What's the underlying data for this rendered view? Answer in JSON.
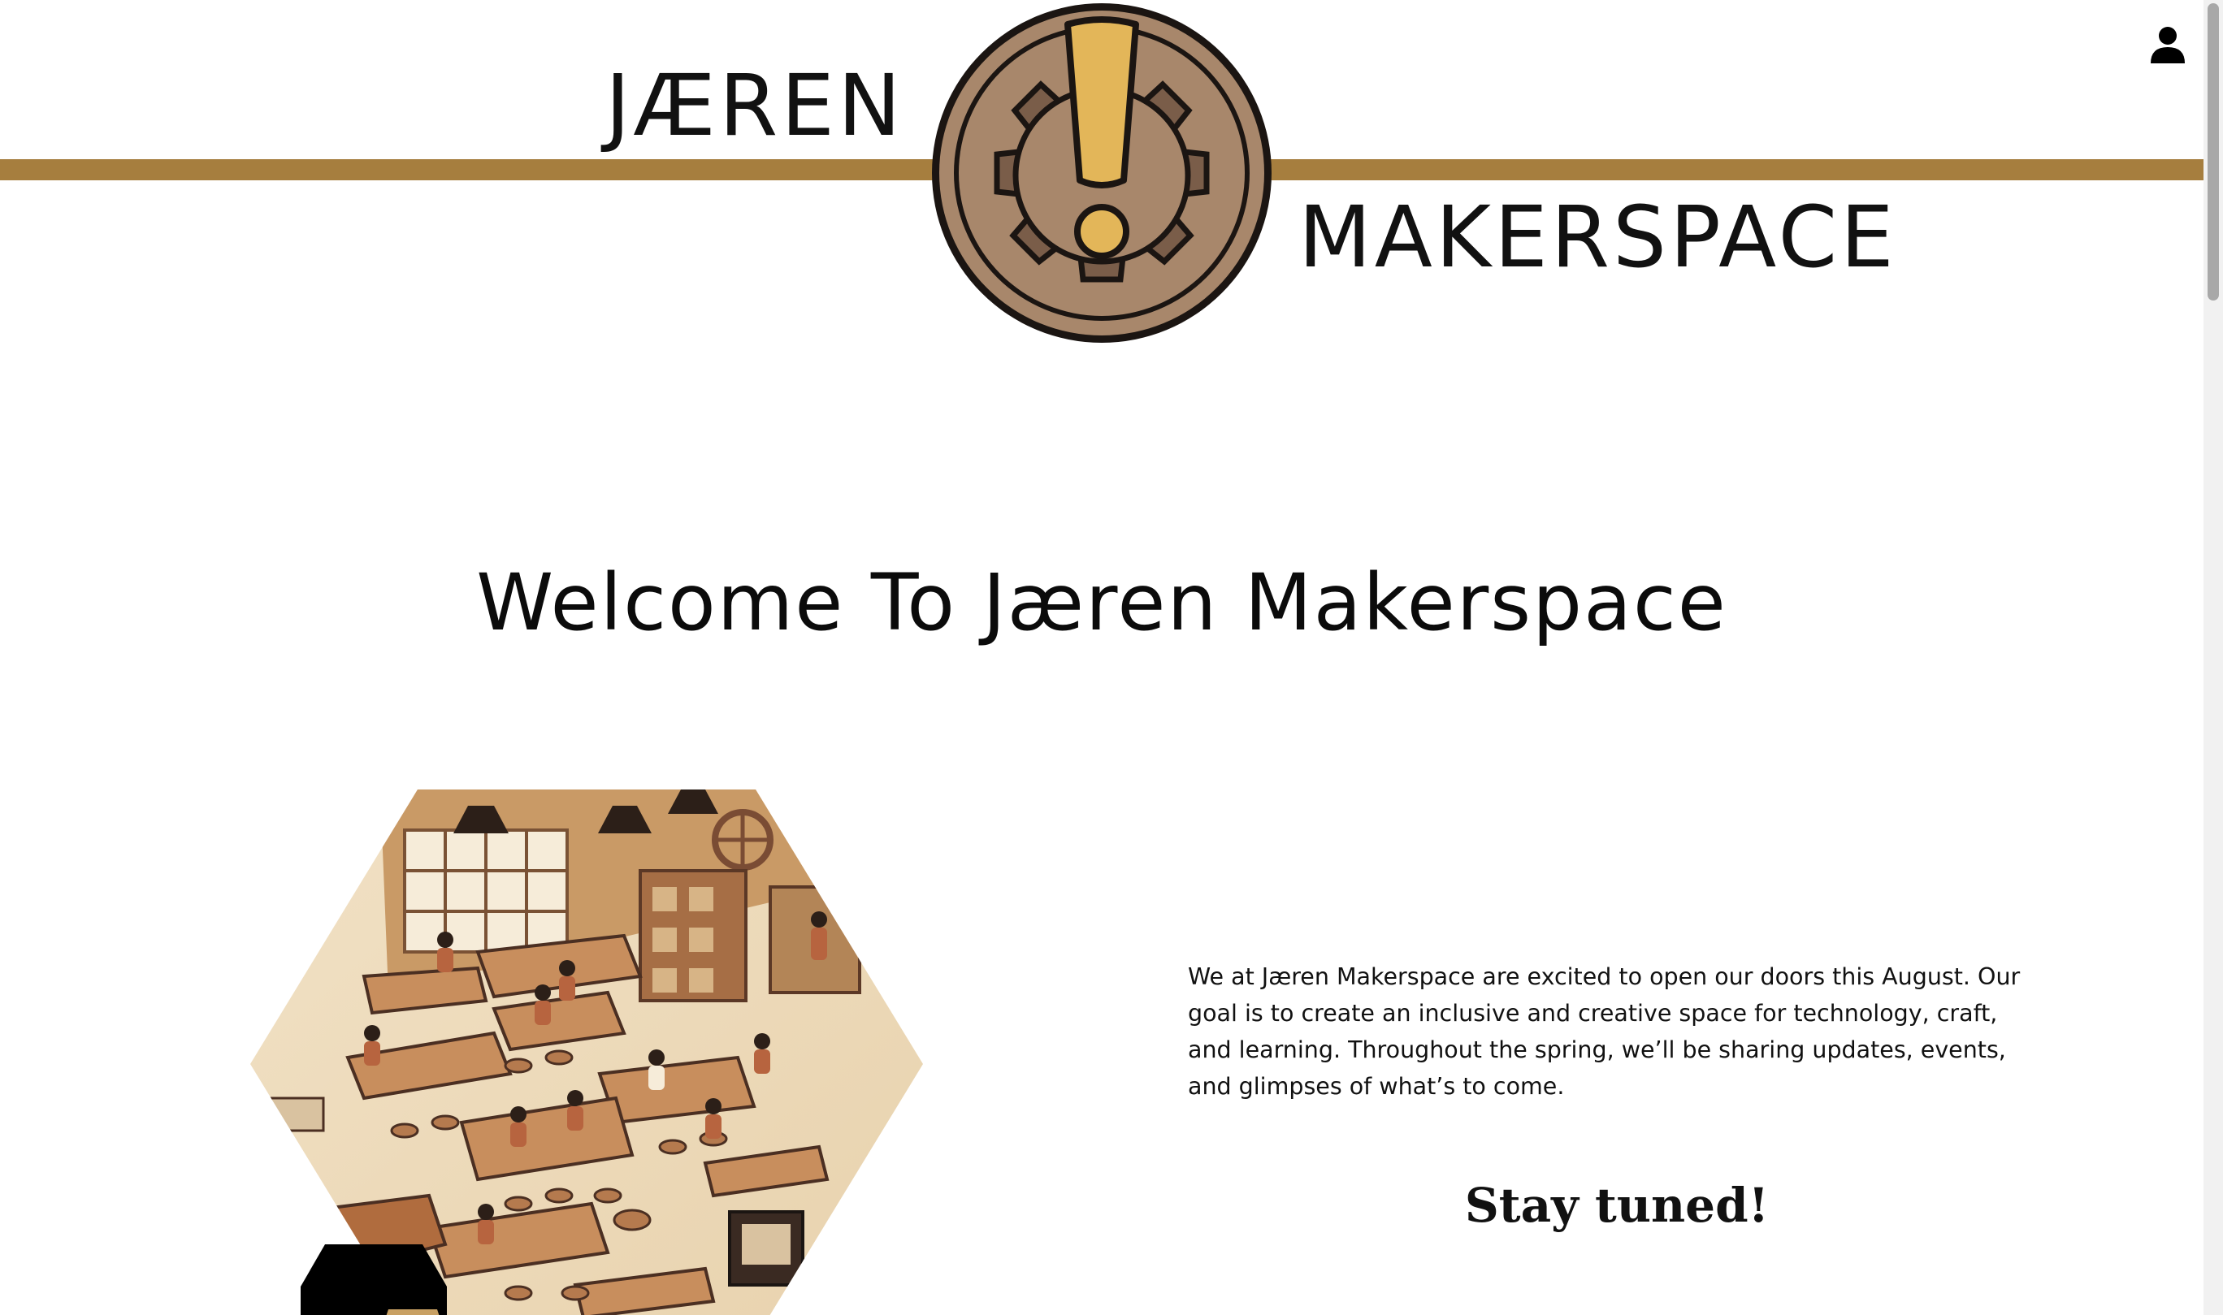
{
  "header": {
    "brand_left": "JÆREN",
    "brand_right": "MAKERSPACE",
    "logo_icon": "gear-exclamation-logo",
    "account_icon": "user-icon"
  },
  "colors": {
    "band": "#a67e3e",
    "logo_outer": "#a8876b",
    "logo_gear": "#7a5d49",
    "logo_mark": "#e3b659",
    "text": "#111111"
  },
  "main": {
    "title": "Welcome To Jæren Makerspace",
    "intro": "We at Jæren Makerspace are excited to open our doors this August. Our goal is to create an inclusive and creative space for technology, craft, and learning. Throughout the spring, we’ll be sharing updates, events, and glimpses of what’s to come.",
    "tagline": "Stay tuned!",
    "hero_image": "makerspace-workshop-illustration"
  }
}
